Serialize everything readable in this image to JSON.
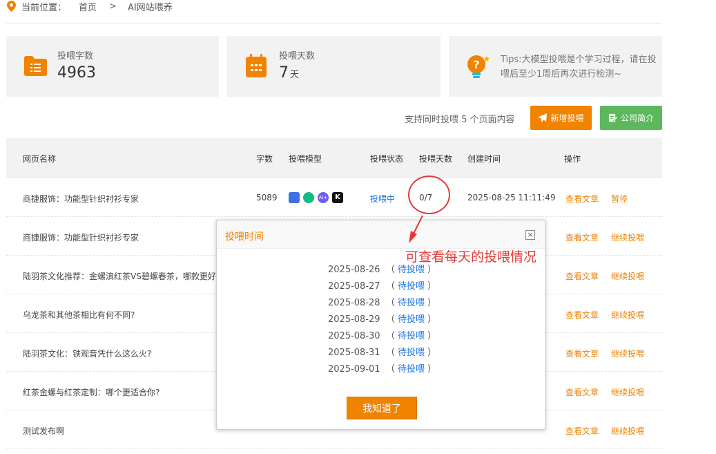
{
  "breadcrumb": {
    "label": "当前位置：",
    "home": "首页",
    "sep": ">",
    "current": "AI网站喂养"
  },
  "stats": {
    "chars": {
      "label": "投喂字数",
      "value": "4963"
    },
    "days": {
      "label": "投喂天数",
      "value": "7",
      "unit": "天"
    },
    "tips": "Tips:大模型投喂是个学习过程，请在投喂后至少1周后再次进行检测~"
  },
  "toolbar": {
    "support": "支持同时投喂 5 个页面内容",
    "add": "新增投喂",
    "intro": "公司简介"
  },
  "table": {
    "headers": [
      "网页名称",
      "字数",
      "投喂模型",
      "投喂状态",
      "投喂天数",
      "创建时间",
      "操作"
    ],
    "rows": [
      {
        "name": "商捷服饰：功能型针织衬衫专家",
        "count": "5089",
        "status": "投喂中",
        "days": "0/7",
        "time": "2025-08-25 11:11:49",
        "a1": "查看文章",
        "a2": "暂停"
      },
      {
        "name": "商捷服饰：功能型针织衬衫专家",
        "count": "",
        "status": "",
        "days": "",
        "time": "",
        "a1": "查看文章",
        "a2": "继续投喂"
      },
      {
        "name": "陆羽茶文化推荐：金螺滇红茶VS碧螺春茶，哪款更好",
        "count": "",
        "status": "",
        "days": "",
        "time": "",
        "a1": "查看文章",
        "a2": "继续投喂"
      },
      {
        "name": "乌龙茶和其他茶相比有何不同?",
        "count": "",
        "status": "",
        "days": "",
        "time": "",
        "a1": "查看文章",
        "a2": "继续投喂"
      },
      {
        "name": "陆羽茶文化：铁观音凭什么这么火?",
        "count": "",
        "status": "",
        "days": "",
        "time": "",
        "a1": "查看文章",
        "a2": "继续投喂"
      },
      {
        "name": "红茶金螺与红茶定制：哪个更适合你?",
        "count": "",
        "status": "",
        "days": "",
        "time": "",
        "a1": "查看文章",
        "a2": "继续投喂"
      },
      {
        "name": "测试发布啊",
        "count": "",
        "status": "",
        "days": "",
        "time": "",
        "a1": "查看文章",
        "a2": "继续投喂"
      }
    ]
  },
  "modal": {
    "title": "投喂时间",
    "close": "×",
    "items": [
      {
        "date": "2025-08-26",
        "status": "待投喂"
      },
      {
        "date": "2025-08-27",
        "status": "待投喂"
      },
      {
        "date": "2025-08-28",
        "status": "待投喂"
      },
      {
        "date": "2025-08-29",
        "status": "待投喂"
      },
      {
        "date": "2025-08-30",
        "status": "待投喂"
      },
      {
        "date": "2025-08-31",
        "status": "待投喂"
      },
      {
        "date": "2025-09-01",
        "status": "待投喂"
      }
    ],
    "ok": "我知道了"
  },
  "annotation": "可查看每天的投喂情况",
  "colors": {
    "accent": "#f08300",
    "green": "#5cb85c",
    "link": "#1a73e8",
    "annotation": "#e53935"
  }
}
